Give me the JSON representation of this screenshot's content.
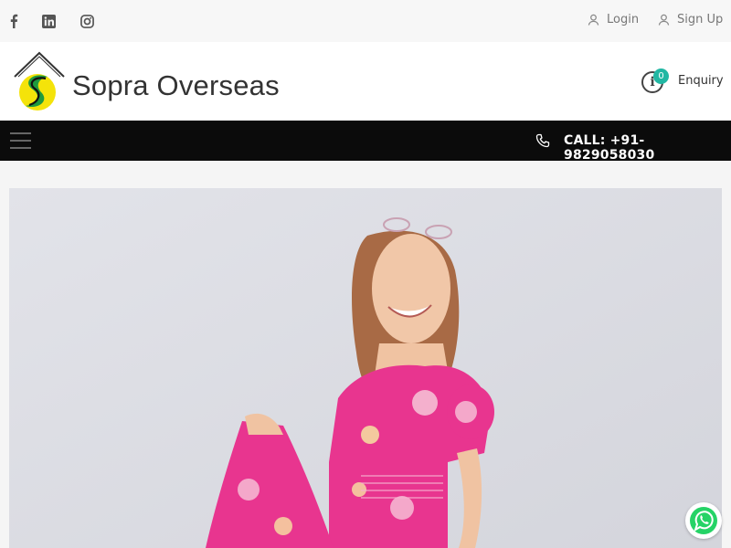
{
  "topbar": {
    "social": [
      {
        "name": "facebook-icon",
        "glyph": "f"
      },
      {
        "name": "linkedin-icon",
        "glyph": "in"
      },
      {
        "name": "instagram-icon",
        "glyph": ""
      }
    ],
    "login_label": "Login",
    "signup_label": "Sign Up"
  },
  "header": {
    "brand_name": "Sopra Overseas",
    "enquiry_count": "0",
    "enquiry_label": "Enquiry"
  },
  "navbar": {
    "call_label": "CALL: +91-9829058030"
  },
  "colors": {
    "accent_badge": "#21b7a3",
    "navbar_bg": "#0b0b0b",
    "whatsapp_green": "#25d366",
    "dress_pink": "#e8358f"
  }
}
